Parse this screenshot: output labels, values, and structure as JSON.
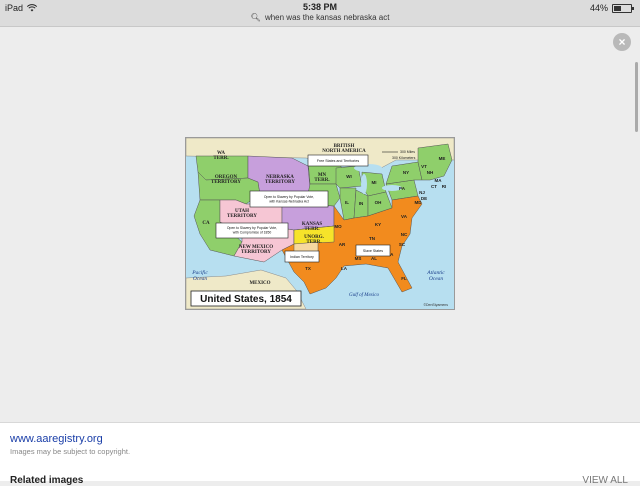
{
  "status_bar": {
    "device": "iPad",
    "time": "5:38 PM",
    "battery": "44%",
    "battery_level": 0.44,
    "wifi_icon": "wifi-icon",
    "lock_icon": "lock-rotation-icon"
  },
  "search": {
    "query": "when was the kansas nebraska act",
    "icon": "search-icon"
  },
  "viewer": {
    "close_icon": "close-icon",
    "close_glyph": "×"
  },
  "map": {
    "title": "United States, 1854",
    "regions": {
      "british": "BRITISH\nNORTH AMERICA",
      "wa": "WA\nTERR.",
      "oregon": "OREGON\nTERRITORY",
      "nebraska": "NEBRASKA\nTERRITORY",
      "mn": "MN\nTERR.",
      "utah": "UTAH\nTERRITORY",
      "kansas": "KANSAS\nTERR.",
      "ca": "CA",
      "new_mexico": "NEW MEXICO\nTERRITORY",
      "unorg": "UNORG.\nTERR.",
      "mexico": "MEXICO",
      "pacific": "Pacific\nOcean",
      "atlantic": "Atlantic\nOcean",
      "gulf": "Gulf of Mexico",
      "lake": "Lake\nSuperior"
    },
    "states": [
      "WI",
      "MI",
      "IA",
      "IL",
      "IN",
      "OH",
      "PA",
      "NY",
      "VT",
      "ME",
      "NH",
      "MA",
      "CT",
      "RI",
      "NJ",
      "DE",
      "MD",
      "MO",
      "KY",
      "VA",
      "TN",
      "NC",
      "AR",
      "SC",
      "GA",
      "AL",
      "MS",
      "LA",
      "TX",
      "FL"
    ],
    "labels": {
      "free": "Free States and Territories",
      "popular_kansas": "Open to Slavery by Popular Vote, with Kansas-Nebraska Act",
      "popular_1850": "Open to Slavery by Popular Vote, with Compromise of 1850",
      "slave": "Slave States",
      "indian": "Indian Territory"
    },
    "scale": {
      "miles": "300 Miles",
      "km": "300 Kilometers"
    },
    "credit": "©DenStyamens",
    "colors": {
      "ocean": "#b7dff0",
      "free": "#8fcf6b",
      "kansas_nebraska": "#c79fdc",
      "compromise_1850": "#f6c6d4",
      "slave": "#f28b1e",
      "unorganized": "#f6e32a",
      "indian": "#f6d7a0",
      "foreign": "#efe9c8"
    }
  },
  "result": {
    "source": "www.aaregistry.org",
    "note": "Images may be subject to copyright.",
    "related": "Related images",
    "view_all": "VIEW ALL"
  }
}
